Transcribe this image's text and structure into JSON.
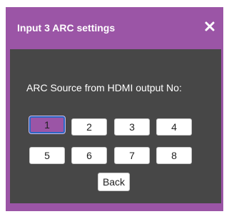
{
  "dialog": {
    "title": "Input 3 ARC settings",
    "close_icon": "close-icon",
    "prompt": "ARC Source from HDMI output No:",
    "outputs": [
      "1",
      "2",
      "3",
      "4",
      "5",
      "6",
      "7",
      "8"
    ],
    "selected_output": "1",
    "back_label": "Back"
  },
  "colors": {
    "accent": "#9b55a6",
    "panel": "#474747",
    "selection_border": "#2b67c4"
  }
}
